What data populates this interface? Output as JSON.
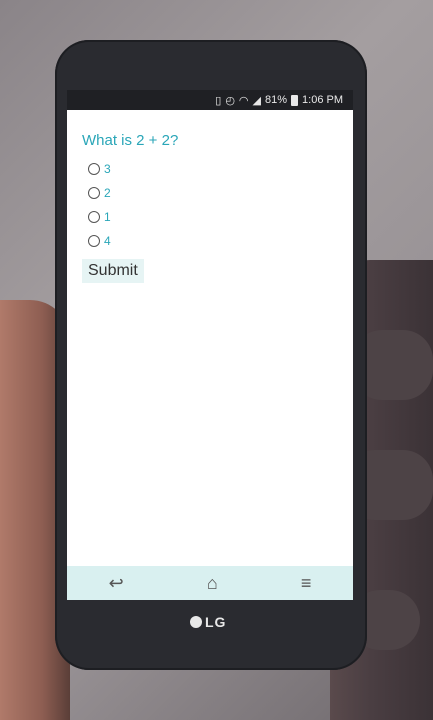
{
  "status_bar": {
    "battery": "81%",
    "time": "1:06 PM",
    "icons": [
      "sim-icon",
      "alarm-icon",
      "wifi-icon",
      "signal-icon",
      "battery-icon"
    ]
  },
  "quiz": {
    "question": "What is 2 + 2?",
    "options": [
      "3",
      "2",
      "1",
      "4"
    ],
    "submit_label": "Submit"
  },
  "nav_bar": {
    "icons": [
      "back-icon",
      "home-icon",
      "menu-icon"
    ]
  },
  "device": {
    "brand": "LG"
  },
  "colors": {
    "accent": "#2aa6b8",
    "nav_bar": "#d9f0f0",
    "submit_bg": "#e6f4f4"
  }
}
